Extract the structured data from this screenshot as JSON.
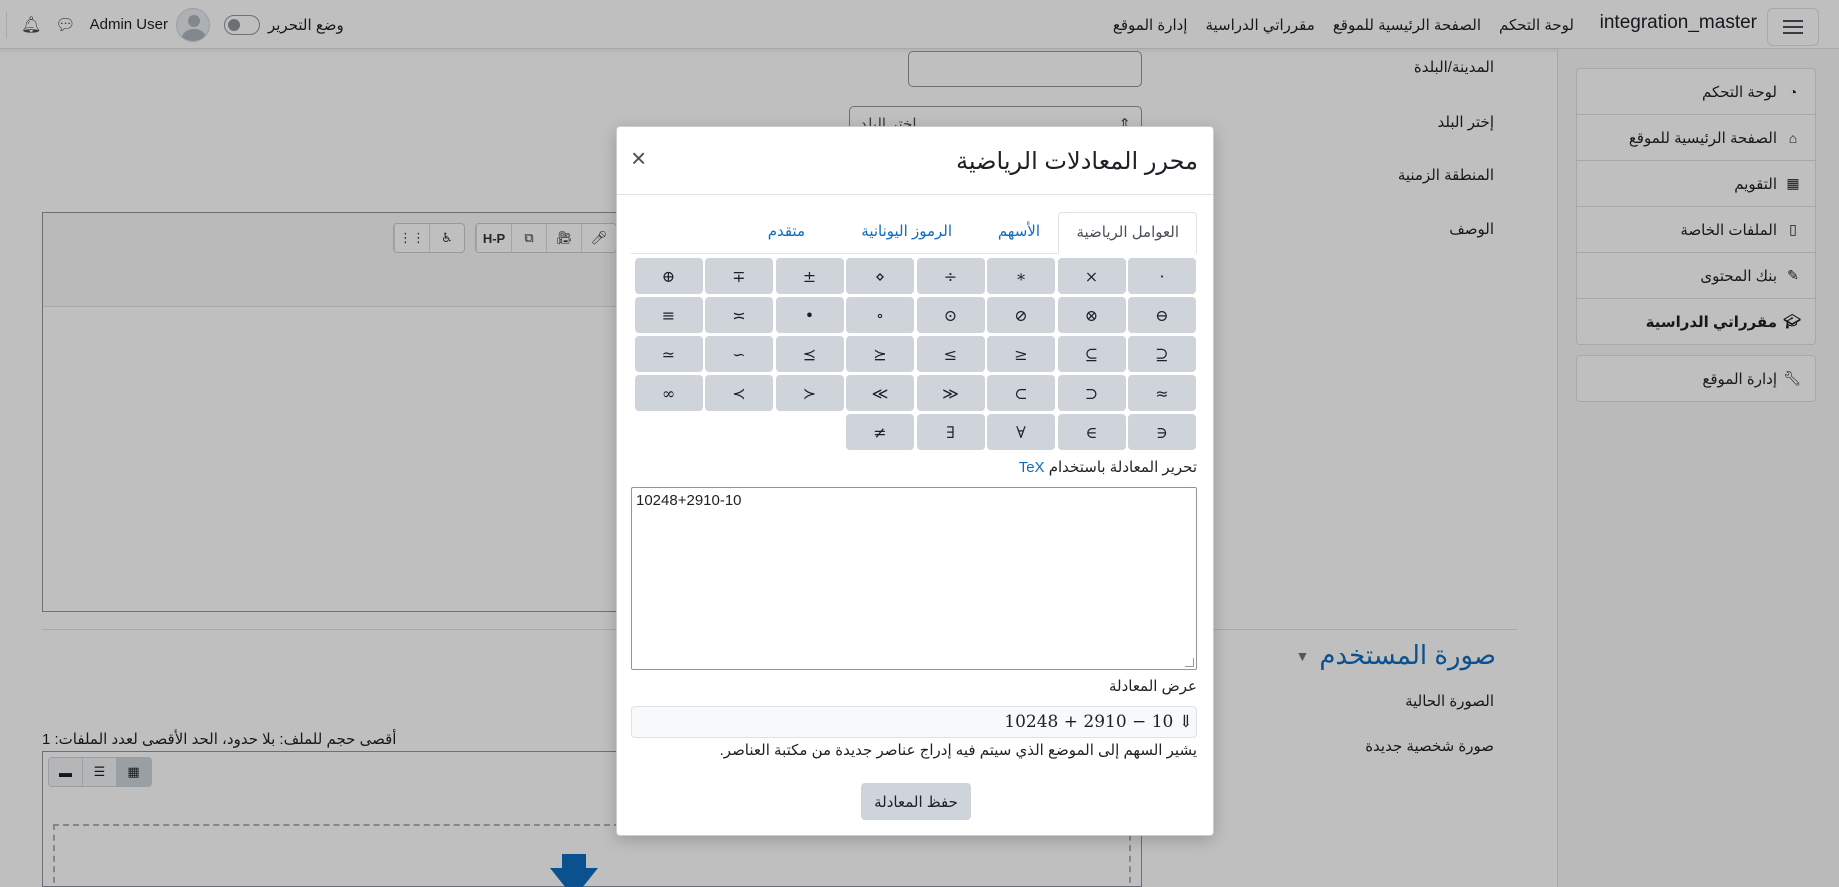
{
  "navbar": {
    "brand": "integration_master",
    "links": [
      "لوحة التحكم",
      "الصفحة الرئيسية للموقع",
      "مقرراتي الدراسية",
      "إدارة الموقع"
    ],
    "user_name": "Admin User",
    "edit_mode_label": "وضع التحرير"
  },
  "drawer": {
    "items": [
      {
        "label": "لوحة التحكم",
        "icon": "dashboard-icon",
        "glyph": "◔"
      },
      {
        "label": "الصفحة الرئيسية للموقع",
        "icon": "home-icon",
        "glyph": "⌂"
      },
      {
        "label": "التقويم",
        "icon": "calendar-icon",
        "glyph": "▦"
      },
      {
        "label": "الملفات الخاصة",
        "icon": "file-icon",
        "glyph": "▯"
      },
      {
        "label": "بنك المحتوى",
        "icon": "paint-brush-icon",
        "glyph": "✎"
      },
      {
        "label": "مقرراتي الدراسية",
        "icon": "graduation-cap-icon",
        "glyph": "🎓"
      }
    ],
    "admin_item": {
      "label": "إدارة الموقع",
      "icon": "wrench-icon",
      "glyph": "🔧"
    }
  },
  "form": {
    "city_label": "المدينة/البلدة",
    "country_label": "إختر البلد",
    "country_placeholder": "إختر البلد",
    "timezone_label": "المنطقة الزمنية",
    "description_label": "الوصف",
    "user_picture_section": "صورة المستخدم",
    "current_picture_label": "الصورة الحالية",
    "new_picture_label": "صورة شخصية جديدة",
    "file_limits": "أقصى حجم للملف: بلا حدود، الحد الأقصى لعدد الملفات: 1"
  },
  "modal": {
    "title": "محرر المعادلات الرياضية",
    "tabs": [
      "العوامل الرياضية",
      "الأسهم",
      "الرموز اليونانية",
      "متقدم"
    ],
    "symbols": [
      [
        "·",
        "×",
        "∗",
        "÷",
        "⋄",
        "±",
        "∓",
        "⊕"
      ],
      [
        "⊖",
        "⊗",
        "⊘",
        "⊙",
        "∘",
        "•",
        "≍",
        "≡"
      ],
      [
        "⊆",
        "⊇",
        "≤",
        "≥",
        "⪯",
        "⪰",
        "∼",
        "≃"
      ],
      [
        "≈",
        "⊂",
        "⊃",
        "≪",
        "≫",
        "≺",
        "≻",
        "∞"
      ],
      [
        "∈",
        "∋",
        "∀",
        "∃",
        "≠"
      ]
    ],
    "tex_label_prefix": "تحرير المعادلة باستخدام",
    "tex_link": "TeX",
    "tex_value": "10248+2910-10",
    "preview_label": "عرض المعادلة",
    "preview_math": "10248 + 2910 − 10",
    "preview_cursor": "⇓",
    "hint": "يشير السهم إلى الموضع الذي سيتم فيه إدراج عناصر جديدة من مكتبة العناصر.",
    "save_button": "حفظ المعادلة"
  }
}
